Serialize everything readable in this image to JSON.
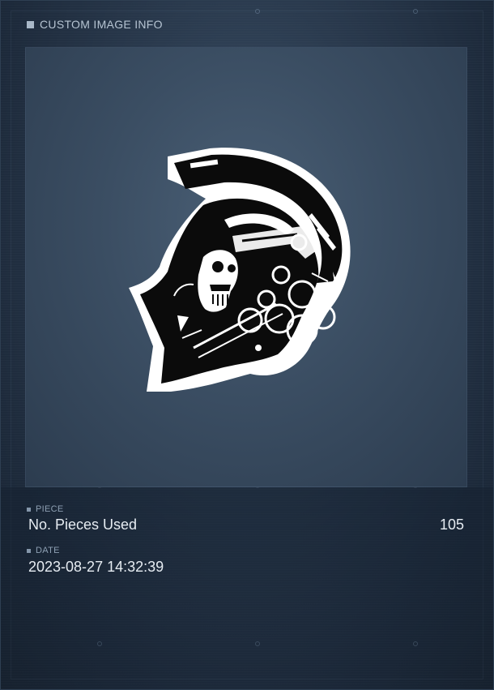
{
  "header": {
    "title": "CUSTOM IMAGE INFO"
  },
  "image": {
    "icon": "skull-helmet-logo-icon"
  },
  "piece": {
    "label": "PIECE",
    "name": "No. Pieces Used",
    "count": "105"
  },
  "date": {
    "label": "DATE",
    "value": "2023-08-27 14:32:39"
  },
  "colors": {
    "panel_bg": "#2a3a4e",
    "text_primary": "#e6ecf2",
    "text_label": "#8ea0b3"
  }
}
